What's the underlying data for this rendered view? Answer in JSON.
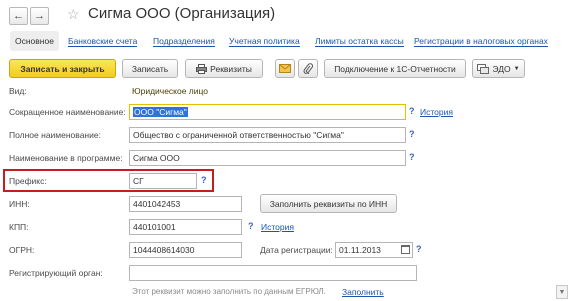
{
  "header": {
    "back_icon": "arrow-left-icon",
    "forward_icon": "arrow-right-icon",
    "favorite_icon": "star-icon",
    "title": "Сигма ООО (Организация)"
  },
  "tabs": [
    {
      "label": "Основное"
    },
    {
      "label": "Банковские счета"
    },
    {
      "label": "Подразделения"
    },
    {
      "label": "Учетная политика"
    },
    {
      "label": "Лимиты остатка кассы"
    },
    {
      "label": "Регистрации в налоговых органах"
    }
  ],
  "toolbar": {
    "save_close": "Записать и закрыть",
    "save": "Записать",
    "requisites": "Реквизиты",
    "connect": "Подключение к 1С-Отчетности",
    "edo": "ЭДО"
  },
  "form": {
    "type_label": "Вид:",
    "type_value": "Юридическое лицо",
    "short_name_label": "Сокращенное наименование:",
    "short_name_value": "ООО \"Сигма\"",
    "full_name_label": "Полное наименование:",
    "full_name_value": "Общество с ограниченной ответственностью \"Сигма\"",
    "program_name_label": "Наименование в программе:",
    "program_name_value": "Сигма ООО",
    "prefix_label": "Префикс:",
    "prefix_value": "СГ",
    "inn_label": "ИНН:",
    "inn_value": "4401042453",
    "fill_by_inn": "Заполнить реквизиты по ИНН",
    "kpp_label": "КПП:",
    "kpp_value": "440101001",
    "ogrn_label": "ОГРН:",
    "ogrn_value": "1044408614030",
    "reg_date_label": "Дата регистрации:",
    "reg_date_value": "01.11.2013",
    "reg_authority_label": "Регистрирующий орган:",
    "reg_authority_value": "",
    "egrul_hint": "Этот реквизит можно заполнить по данным ЕГРЮЛ.",
    "fill_link": "Заполнить",
    "history_link": "История",
    "help": "?"
  }
}
